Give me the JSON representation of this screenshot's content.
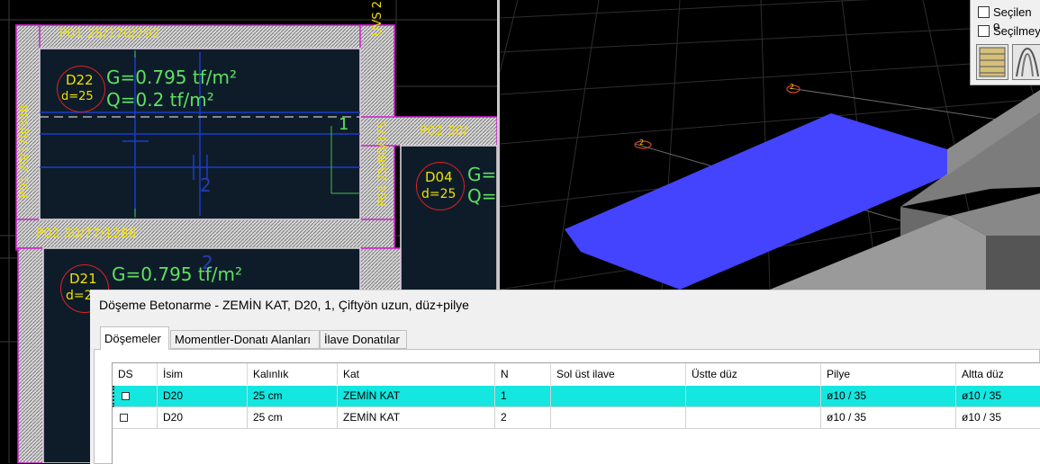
{
  "cad": {
    "slab_labels": {
      "top_strip": "P01 25/170/292",
      "mid_strip": "P02 30/77/1286",
      "right_strip": "P02 30/",
      "left_vertical": "P01 20/170/338",
      "mid_vertical": "P04 25/80/375",
      "right_vertical": "UVS 25/170/370"
    },
    "slabs": [
      {
        "id": "D22",
        "thickness": "d=25",
        "g": "G=0.795 tf/m²",
        "q": "Q=0.2 tf/m²"
      },
      {
        "id": "D04",
        "thickness": "d=25",
        "g": "G=",
        "q": "Q="
      },
      {
        "id": "D21",
        "thickness": "d=2",
        "g": "G=0.795 tf/m²",
        "q": ""
      }
    ],
    "numbers": {
      "n1": "1",
      "n2": "2",
      "n2b": "2"
    }
  },
  "view3d": {
    "markers": [
      "2",
      "2"
    ],
    "colors": {
      "slab": "#4444ff",
      "beam": "#8a8a8a"
    }
  },
  "panel": {
    "checkbox1": "Seçilen o",
    "checkbox2": "Seçilmeye"
  },
  "dialog": {
    "title": "Döşeme Betonarme - ZEMİN KAT, D20, 1, Çiftyön uzun, düz+pilye",
    "tabs": [
      "Döşemeler",
      "Momentler-Donatı Alanları",
      "İlave Donatılar"
    ],
    "columns": [
      "DS",
      "İsim",
      "Kalınlık",
      "Kat",
      "N",
      "Sol üst ilave",
      "Üstte düz",
      "Pilye",
      "Altta düz"
    ],
    "rows": [
      {
        "isim": "D20",
        "kalinlik": "25 cm",
        "kat": "ZEMİN KAT",
        "n": "1",
        "sol": "",
        "ustte": "",
        "pilye": "ø10 / 35",
        "altta": "ø10 / 35"
      },
      {
        "isim": "D20",
        "kalinlik": "25 cm",
        "kat": "ZEMİN KAT",
        "n": "2",
        "sol": "",
        "ustte": "",
        "pilye": "ø10 / 35",
        "altta": "ø10 / 35"
      }
    ],
    "selected_row_color": "#14e6e0"
  }
}
